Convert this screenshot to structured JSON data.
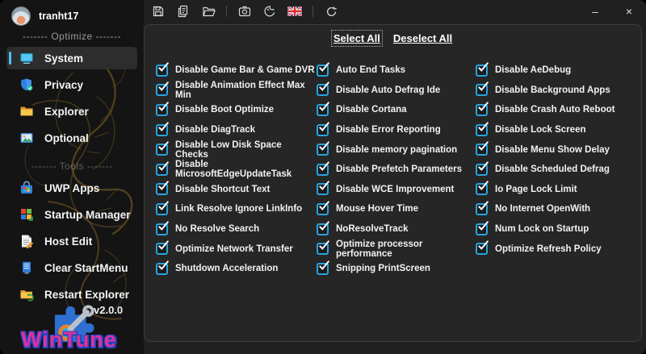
{
  "titlebar": {
    "icons": [
      "save",
      "export",
      "open-folder",
      "screenshot",
      "theme",
      "language-uk-flag",
      "refresh"
    ],
    "minimize_label": "–",
    "close_label": "×"
  },
  "sidebar": {
    "username": "tranht17",
    "groups": [
      {
        "divider": "------- Optimize -------",
        "items": [
          {
            "label": "System",
            "icon": "system",
            "selected": true
          },
          {
            "label": "Privacy",
            "icon": "privacy",
            "selected": false
          },
          {
            "label": "Explorer",
            "icon": "explorer",
            "selected": false
          },
          {
            "label": "Optional",
            "icon": "optional",
            "selected": false
          }
        ]
      },
      {
        "divider": "------- Tools -------",
        "items": [
          {
            "label": "UWP Apps",
            "icon": "uwp-apps",
            "selected": false
          },
          {
            "label": "Startup Manager",
            "icon": "startup-manager",
            "selected": false
          },
          {
            "label": "Host Edit",
            "icon": "host-edit",
            "selected": false
          },
          {
            "label": "Clear StartMenu",
            "icon": "clear-startmenu",
            "selected": false
          },
          {
            "label": "Restart Explorer",
            "icon": "restart-explorer",
            "selected": false
          }
        ]
      }
    ],
    "version": "v2.0.0",
    "brand": "WinTune"
  },
  "main": {
    "select_all_label": "Select All",
    "deselect_all_label": "Deselect All",
    "all_checked": true,
    "columns": [
      [
        "Disable Game Bar & Game DVR",
        "Disable Animation Effect Max Min",
        "Disable Boot Optimize",
        "Disable DiagTrack",
        "Disable Low Disk Space Checks",
        "Disable MicrosoftEdgeUpdateTask",
        "Disable Shortcut Text",
        "Link Resolve Ignore LinkInfo",
        "No Resolve Search",
        "Optimize Network Transfer",
        "Shutdown Acceleration"
      ],
      [
        "Auto End Tasks",
        "Disable Auto Defrag Ide",
        "Disable Cortana",
        "Disable Error Reporting",
        "Disable memory pagination",
        "Disable Prefetch Parameters",
        "Disable WCE Improvement",
        "Mouse Hover Time",
        "NoResolveTrack",
        "Optimize processor performance",
        "Snipping PrintScreen"
      ],
      [
        "Disable AeDebug",
        "Disable Background Apps",
        "Disable Crash Auto Reboot",
        "Disable Lock Screen",
        "Disable Menu Show Delay",
        "Disable Scheduled Defrag",
        "Io Page Lock Limit",
        "No Internet OpenWith",
        "Num Lock on Startup",
        "Optimize Refresh Policy"
      ]
    ]
  },
  "colors": {
    "accent_checkbox": "#27a4e0",
    "selection_pill": "#4cc2ff",
    "brand_magenta": "#e0309a",
    "brand_blue": "#2246c8"
  }
}
